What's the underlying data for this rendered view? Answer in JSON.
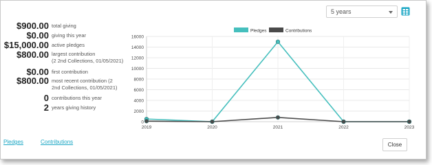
{
  "controls": {
    "period_selected": "5 years"
  },
  "stats": [
    {
      "amount": "$900.00",
      "label": [
        "total giving"
      ]
    },
    {
      "amount": "$0.00",
      "label": [
        "giving this year"
      ]
    },
    {
      "amount": "$15,000.00",
      "label": [
        "active pledges"
      ]
    },
    {
      "amount": "$800.00",
      "label": [
        "largest contribution",
        "(2 2nd Collections, 01/05/2021)"
      ]
    },
    {
      "amount": "$0.00",
      "label": [
        "first contribution"
      ]
    },
    {
      "amount": "$800.00",
      "label": [
        "most recent contribution (2",
        "2nd Collections, 01/05/2021)"
      ]
    },
    {
      "amount": "0",
      "label": [
        "contributions this year"
      ]
    },
    {
      "amount": "2",
      "label": [
        "years giving history"
      ]
    }
  ],
  "footer": {
    "pledges_link": "Pledges",
    "contributions_link": "Contributions",
    "close_label": "Close"
  },
  "colors": {
    "pledges": "#45bfbd",
    "contributions": "#4a4a4a",
    "accent": "#1aa6c4"
  },
  "chart_data": {
    "type": "line",
    "x": [
      "2019",
      "2020",
      "2021",
      "2022",
      "2023"
    ],
    "series": [
      {
        "name": "Pledges",
        "values": [
          500,
          0,
          15000,
          0,
          0
        ]
      },
      {
        "name": "Contributions",
        "values": [
          100,
          0,
          800,
          0,
          0
        ]
      }
    ],
    "ylim": [
      0,
      16000
    ],
    "yticks": [
      "0",
      "2000",
      "4000",
      "6000",
      "8000",
      "10000",
      "12000",
      "14000",
      "16000"
    ],
    "grid": true,
    "legend_position": "top"
  }
}
